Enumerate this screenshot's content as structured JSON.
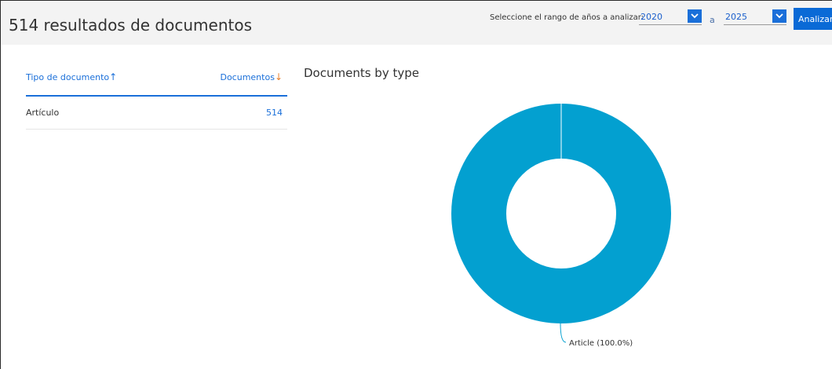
{
  "header": {
    "results_title": "514 resultados de documentos",
    "range_label": "Seleccione el rango de años a analizar:",
    "year_from": "2020",
    "to_label": "a",
    "year_to": "2025",
    "analyze_label": "Analizar"
  },
  "table": {
    "col_type": "Tipo de documento",
    "col_docs": "Documentos",
    "rows": [
      {
        "type": "Artículo",
        "count": "514"
      }
    ]
  },
  "chart_title": "Documents by type",
  "chart_data": {
    "type": "pie",
    "title": "Documents by type",
    "donut": true,
    "categories": [
      "Article"
    ],
    "values": [
      514
    ],
    "labels": [
      "Article (100.0%)"
    ],
    "colors": [
      "#03a0d0"
    ]
  },
  "colors": {
    "accent": "#1a6fd9",
    "sort_desc": "#e8812f",
    "slice": "#03a0d0"
  },
  "icons": {
    "sort_asc": "arrow-up-icon",
    "sort_desc": "arrow-down-icon",
    "dropdown": "chevron-down-icon"
  }
}
